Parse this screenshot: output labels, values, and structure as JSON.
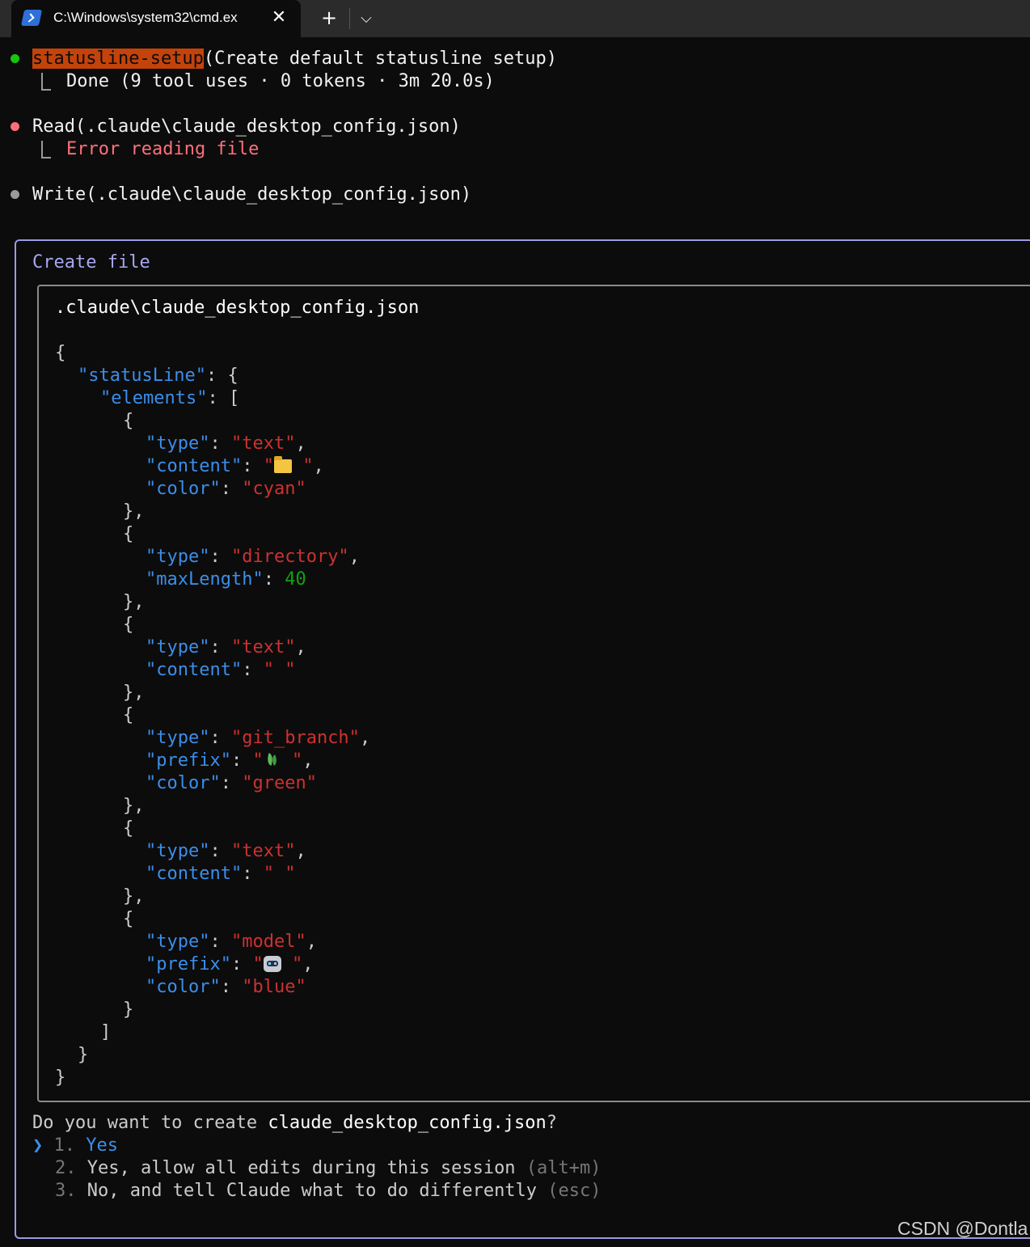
{
  "window": {
    "tab_title": "C:\\Windows\\system32\\cmd.ex",
    "tab_icon": "powershell-icon",
    "close_glyph": "✕",
    "new_tab_glyph": "+",
    "dropdown_glyph": "⌵"
  },
  "log": {
    "entry1": {
      "status_color": "#16c60c",
      "tool": "statusline-setup",
      "args": "(Create default statusline setup)",
      "result": "Done (9 tool uses · 0 tokens · 3m 20.0s)"
    },
    "entry2": {
      "status_color": "#ff6f7b",
      "tool": "Read",
      "args": "(.claude\\claude_desktop_config.json)",
      "result": "Error reading file"
    },
    "entry3": {
      "status_color": "#9a9a9a",
      "tool": "Write",
      "args": "(.claude\\claude_desktop_config.json)"
    }
  },
  "dialog": {
    "title": "Create file",
    "file_path": ".claude\\claude_desktop_config.json",
    "code": {
      "open_brace": "{",
      "statusLine_key": "\"statusLine\"",
      "elements_key": "\"elements\"",
      "open_bracket": "[",
      "close_bracket": "]",
      "close_brace": "}",
      "type_key": "\"type\"",
      "content_key": "\"content\"",
      "color_key": "\"color\"",
      "maxLength_key": "\"maxLength\"",
      "prefix_key": "\"prefix\"",
      "el1": {
        "type": "\"text\"",
        "content_open": "\"",
        "content_close": " \"",
        "color": "\"cyan\""
      },
      "el2": {
        "type": "\"directory\"",
        "maxLength": "40"
      },
      "el3": {
        "type": "\"text\"",
        "content": "\" \""
      },
      "el4": {
        "type": "\"git_branch\"",
        "prefix_open": "\"",
        "prefix_close": " \"",
        "color": "\"green\""
      },
      "el5": {
        "type": "\"text\"",
        "content": "\" \""
      },
      "el6": {
        "type": "\"model\"",
        "prefix_open": "\"",
        "prefix_close": " \"",
        "color": "\"blue\""
      }
    },
    "question_prefix": "Do you want to create ",
    "question_file": "claude_desktop_config.json",
    "question_suffix": "?",
    "cursor": "❯",
    "options": [
      {
        "num": "1.",
        "label": "Yes",
        "hint": ""
      },
      {
        "num": "2.",
        "label": "Yes, allow all edits during this session",
        "hint": "(alt+m)"
      },
      {
        "num": "3.",
        "label": "No, and tell Claude what to do differently",
        "hint": "(esc)"
      }
    ]
  },
  "watermark": "CSDN @Dontla"
}
